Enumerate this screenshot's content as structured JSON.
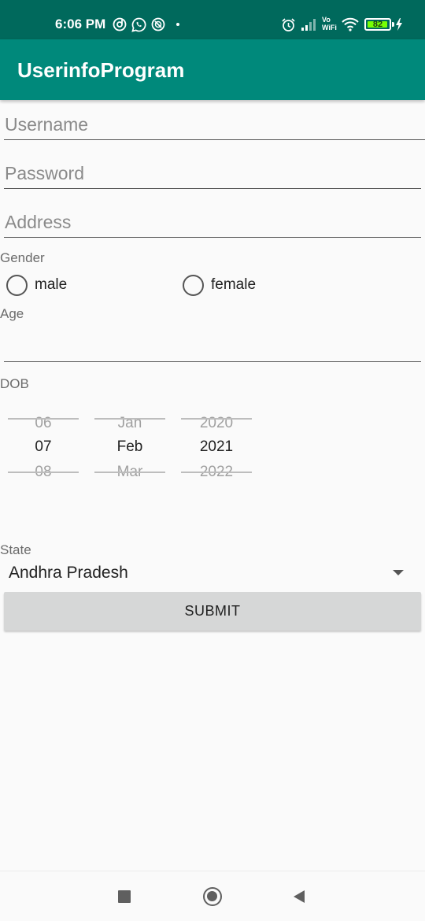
{
  "status_bar": {
    "time": "6:06 PM",
    "battery": "82",
    "icons": [
      "tiktok-icon",
      "whatsapp-icon",
      "data-saver-icon",
      "alarm-icon",
      "signal-icon",
      "vowifi-icon",
      "wifi-icon",
      "battery-icon",
      "charging-icon"
    ],
    "vowifi_top": "Vo",
    "vowifi_bottom": "WiFi"
  },
  "app_bar": {
    "title": "UserinfoProgram"
  },
  "form": {
    "username_placeholder": "Username",
    "password_placeholder": "Password",
    "address_placeholder": "Address",
    "gender_label": "Gender",
    "gender_options": [
      "male",
      "female"
    ],
    "age_label": "Age",
    "dob_label": "DOB",
    "state_label": "State",
    "submit_label": "SUBMIT"
  },
  "date_picker": {
    "day": {
      "prev": "06",
      "current": "07",
      "next": "08"
    },
    "month": {
      "prev": "Jan",
      "current": "Feb",
      "next": "Mar"
    },
    "year": {
      "prev": "2020",
      "current": "2021",
      "next": "2022"
    }
  },
  "state_spinner": {
    "selected": "Andhra Pradesh"
  },
  "colors": {
    "status_bar": "#00695c",
    "app_bar": "#00897b",
    "button": "#d6d7d7",
    "battery_fill": "#76ff03"
  },
  "navigation": {
    "icons": [
      "recents-icon",
      "home-icon",
      "back-icon"
    ]
  }
}
